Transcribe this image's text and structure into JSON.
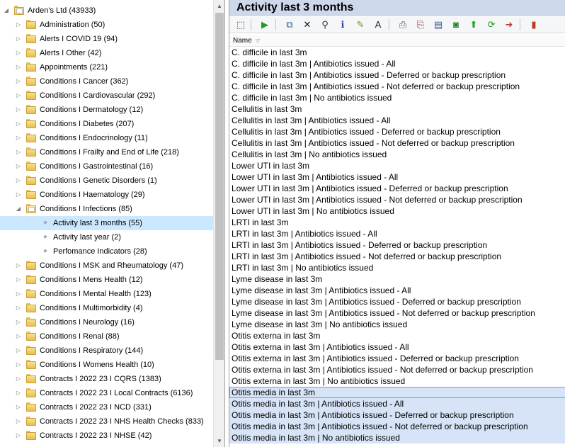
{
  "tree": {
    "root": {
      "label": "Arden's Ltd (43933)"
    },
    "items": [
      {
        "label": "Administration (50)",
        "type": "folder",
        "level": 1,
        "state": "collapsed"
      },
      {
        "label": "Alerts I COVID 19 (94)",
        "type": "folder",
        "level": 1,
        "state": "collapsed"
      },
      {
        "label": "Alerts I Other (42)",
        "type": "folder",
        "level": 1,
        "state": "collapsed"
      },
      {
        "label": "Appointments (221)",
        "type": "folder",
        "level": 1,
        "state": "collapsed"
      },
      {
        "label": "Conditions I Cancer (362)",
        "type": "folder",
        "level": 1,
        "state": "collapsed"
      },
      {
        "label": "Conditions I Cardiovascular (292)",
        "type": "folder",
        "level": 1,
        "state": "collapsed"
      },
      {
        "label": "Conditions I Dermatology (12)",
        "type": "folder",
        "level": 1,
        "state": "collapsed"
      },
      {
        "label": "Conditions I Diabetes (207)",
        "type": "folder",
        "level": 1,
        "state": "collapsed"
      },
      {
        "label": "Conditions I Endocrinology (11)",
        "type": "folder",
        "level": 1,
        "state": "collapsed"
      },
      {
        "label": "Conditions I Frailty and End of Life (218)",
        "type": "folder",
        "level": 1,
        "state": "collapsed"
      },
      {
        "label": "Conditions I Gastrointestinal (16)",
        "type": "folder",
        "level": 1,
        "state": "collapsed"
      },
      {
        "label": "Conditions I Genetic Disorders (1)",
        "type": "folder",
        "level": 1,
        "state": "collapsed"
      },
      {
        "label": "Conditions I Haematology (29)",
        "type": "folder",
        "level": 1,
        "state": "collapsed"
      },
      {
        "label": "Conditions I Infections (85)",
        "type": "folder",
        "level": 1,
        "state": "expanded"
      },
      {
        "label": "Activity last 3 months (55)",
        "type": "leaf",
        "level": 2,
        "state": "selected"
      },
      {
        "label": "Activity last year (2)",
        "type": "leaf",
        "level": 2,
        "state": "none"
      },
      {
        "label": "Perfomance Indicators (28)",
        "type": "leaf",
        "level": 2,
        "state": "none"
      },
      {
        "label": "Conditions I MSK and Rheumatology (47)",
        "type": "folder",
        "level": 1,
        "state": "collapsed"
      },
      {
        "label": "Conditions I Mens Health (12)",
        "type": "folder",
        "level": 1,
        "state": "collapsed"
      },
      {
        "label": "Conditions I Mental Health (123)",
        "type": "folder",
        "level": 1,
        "state": "collapsed"
      },
      {
        "label": "Conditions I Multimorbidity (4)",
        "type": "folder",
        "level": 1,
        "state": "collapsed"
      },
      {
        "label": "Conditions I Neurology (16)",
        "type": "folder",
        "level": 1,
        "state": "collapsed"
      },
      {
        "label": "Conditions I Renal (88)",
        "type": "folder",
        "level": 1,
        "state": "collapsed"
      },
      {
        "label": "Conditions I Respiratory (144)",
        "type": "folder",
        "level": 1,
        "state": "collapsed"
      },
      {
        "label": "Conditions I Womens Health (10)",
        "type": "folder",
        "level": 1,
        "state": "collapsed"
      },
      {
        "label": "Contracts I 2022 23 I CQRS (1383)",
        "type": "folder",
        "level": 1,
        "state": "collapsed"
      },
      {
        "label": "Contracts I 2022 23 I Local Contracts (6136)",
        "type": "folder",
        "level": 1,
        "state": "collapsed"
      },
      {
        "label": "Contracts I 2022 23 I NCD (331)",
        "type": "folder",
        "level": 1,
        "state": "collapsed"
      },
      {
        "label": "Contracts I 2022 23 I NHS Health Checks (833)",
        "type": "folder",
        "level": 1,
        "state": "collapsed"
      },
      {
        "label": "Contracts I 2022 23 I NHSE (42)",
        "type": "folder",
        "level": 1,
        "state": "collapsed"
      }
    ]
  },
  "panel": {
    "title": "Activity last 3 months",
    "column_header": "Name",
    "toolbar": [
      {
        "name": "select-icon",
        "glyph": "⬚",
        "color": "#333333"
      },
      {
        "name": "run-icon",
        "glyph": "▶",
        "color": "#1e9e1e"
      },
      {
        "name": "copy-report-icon",
        "glyph": "⧉",
        "color": "#2a5d9c"
      },
      {
        "name": "delete-icon",
        "glyph": "✕",
        "color": "#111111"
      },
      {
        "name": "search-icon",
        "glyph": "⚲",
        "color": "#333333"
      },
      {
        "name": "info-icon",
        "glyph": "ℹ",
        "color": "#2a3fb8"
      },
      {
        "name": "edit-icon",
        "glyph": "✎",
        "color": "#6a9a1a"
      },
      {
        "name": "font-icon",
        "glyph": "A",
        "color": "#222222"
      },
      {
        "name": "print-icon",
        "glyph": "⎙",
        "color": "#555555"
      },
      {
        "name": "print-preview-icon",
        "glyph": "⎘",
        "color": "#8a3a3a"
      },
      {
        "name": "export-icon",
        "glyph": "▤",
        "color": "#3a5a8a"
      },
      {
        "name": "data-icon",
        "glyph": "◙",
        "color": "#1e7a1e"
      },
      {
        "name": "move-up-icon",
        "glyph": "⬆",
        "color": "#1e9e1e"
      },
      {
        "name": "refresh-icon",
        "glyph": "⟳",
        "color": "#1e9e1e"
      },
      {
        "name": "forward-icon",
        "glyph": "➜",
        "color": "#c0392b"
      },
      {
        "name": "book-icon",
        "glyph": "▮",
        "color": "#c0392b"
      }
    ],
    "rows": [
      {
        "text": "C. difficile in last 3m",
        "state": "none"
      },
      {
        "text": "C. difficile in last 3m | Antibiotics issued - All",
        "state": "none"
      },
      {
        "text": "C. difficile in last 3m | Antibiotics issued - Deferred or backup prescription",
        "state": "none"
      },
      {
        "text": "C. difficile in last 3m | Antibiotics issued - Not deferred or backup prescription",
        "state": "none"
      },
      {
        "text": "C. difficile in last 3m | No antibiotics issued",
        "state": "none"
      },
      {
        "text": "Cellulitis in last 3m",
        "state": "none"
      },
      {
        "text": "Cellulitis in last 3m | Antibiotics issued - All",
        "state": "none"
      },
      {
        "text": "Cellulitis in last 3m | Antibiotics issued - Deferred or backup prescription",
        "state": "none"
      },
      {
        "text": "Cellulitis in last 3m | Antibiotics issued - Not deferred or backup prescription",
        "state": "none"
      },
      {
        "text": "Cellulitis in last 3m | No antibiotics issued",
        "state": "none"
      },
      {
        "text": "Lower UTI in last 3m",
        "state": "none"
      },
      {
        "text": "Lower UTI in last 3m | Antibiotics issued - All",
        "state": "none"
      },
      {
        "text": "Lower UTI in last 3m | Antibiotics issued - Deferred or backup prescription",
        "state": "none"
      },
      {
        "text": "Lower UTI in last 3m | Antibiotics issued - Not deferred or backup prescription",
        "state": "none"
      },
      {
        "text": "Lower UTI in last 3m | No antibiotics issued",
        "state": "none"
      },
      {
        "text": "LRTI in last 3m",
        "state": "none"
      },
      {
        "text": "LRTI in last 3m | Antibiotics issued - All",
        "state": "none"
      },
      {
        "text": "LRTI in last 3m | Antibiotics issued - Deferred or backup prescription",
        "state": "none"
      },
      {
        "text": "LRTI in last 3m | Antibiotics issued - Not deferred or backup prescription",
        "state": "none"
      },
      {
        "text": "LRTI in last 3m | No antibiotics issued",
        "state": "none"
      },
      {
        "text": "Lyme disease in last 3m",
        "state": "none"
      },
      {
        "text": "Lyme disease in last 3m | Antibiotics issued - All",
        "state": "none"
      },
      {
        "text": "Lyme disease in last 3m | Antibiotics issued - Deferred or backup prescription",
        "state": "none"
      },
      {
        "text": "Lyme disease in last 3m | Antibiotics issued - Not deferred or backup prescription",
        "state": "none"
      },
      {
        "text": "Lyme disease in last 3m | No antibiotics issued",
        "state": "none"
      },
      {
        "text": "Otitis externa in last 3m",
        "state": "none"
      },
      {
        "text": "Otitis externa in last 3m | Antibiotics issued - All",
        "state": "none"
      },
      {
        "text": "Otitis externa in last 3m | Antibiotics issued - Deferred or backup prescription",
        "state": "none"
      },
      {
        "text": "Otitis externa in last 3m | Antibiotics issued - Not deferred or backup prescription",
        "state": "none"
      },
      {
        "text": "Otitis externa in last 3m | No antibiotics issued",
        "state": "none"
      },
      {
        "text": "Otitis media in last 3m",
        "state": "focus"
      },
      {
        "text": "Otitis media in last 3m | Antibiotics issued - All",
        "state": "sel"
      },
      {
        "text": "Otitis media in last 3m | Antibiotics issued - Deferred or backup prescription",
        "state": "sel"
      },
      {
        "text": "Otitis media in last 3m | Antibiotics issued - Not deferred or backup prescription",
        "state": "sel"
      },
      {
        "text": "Otitis media in last 3m | No antibiotics issued",
        "state": "sel"
      }
    ]
  },
  "colors": {
    "tree_selected": "#cce8ff",
    "header_band": "#cdd9ea",
    "row_selected": "#d7e3f6"
  }
}
